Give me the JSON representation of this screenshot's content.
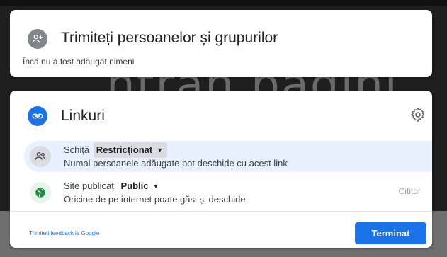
{
  "background": {
    "text": "ntran pagini"
  },
  "share": {
    "title": "Trimiteți persoanelor și grupurilor",
    "subtitle": "Încă nu a fost adăugat nimeni",
    "icon": "person-add-icon"
  },
  "links": {
    "title": "Linkuri",
    "icon": "link-icon",
    "settings_icon": "gear-icon",
    "rows": [
      {
        "label": "Schiță",
        "access": "Restricționat",
        "description": "Numai persoanele adăugate pot deschide cu acest link",
        "icon": "people-icon"
      },
      {
        "label": "Site publicat",
        "access": "Public",
        "description": "Oricine de pe internet poate găsi și deschide",
        "role": "Cititor",
        "icon": "globe-icon"
      }
    ]
  },
  "footer": {
    "feedback": "Trimiteți feedback la Google",
    "done": "Terminat"
  },
  "colors": {
    "accent": "#1a73e8",
    "draft_row_bg": "#e8f0fe",
    "globe_green": "#1e8e3e"
  }
}
